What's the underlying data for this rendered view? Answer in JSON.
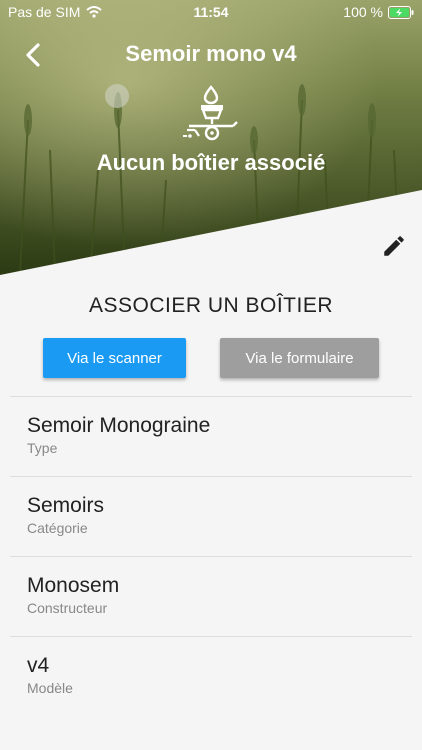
{
  "status_bar": {
    "carrier": "Pas de SIM",
    "time": "11:54",
    "battery": "100 %"
  },
  "header": {
    "title": "Semoir mono v4",
    "subtitle": "Aucun boîtier associé"
  },
  "association": {
    "title": "ASSOCIER UN BOÎTIER",
    "scanner_label": "Via le scanner",
    "form_label": "Via le formulaire"
  },
  "details": [
    {
      "value": "Semoir Monograine",
      "label": "Type"
    },
    {
      "value": "Semoirs",
      "label": "Catégorie"
    },
    {
      "value": "Monosem",
      "label": "Constructeur"
    },
    {
      "value": "v4",
      "label": "Modèle"
    }
  ],
  "colors": {
    "accent": "#1a9af3",
    "secondary_button": "#9e9e9e",
    "background": "#f5f5f5"
  },
  "icons": [
    "wifi-icon",
    "battery-charging-icon",
    "back-arrow-icon",
    "seeder-icon",
    "edit-pencil-icon"
  ]
}
